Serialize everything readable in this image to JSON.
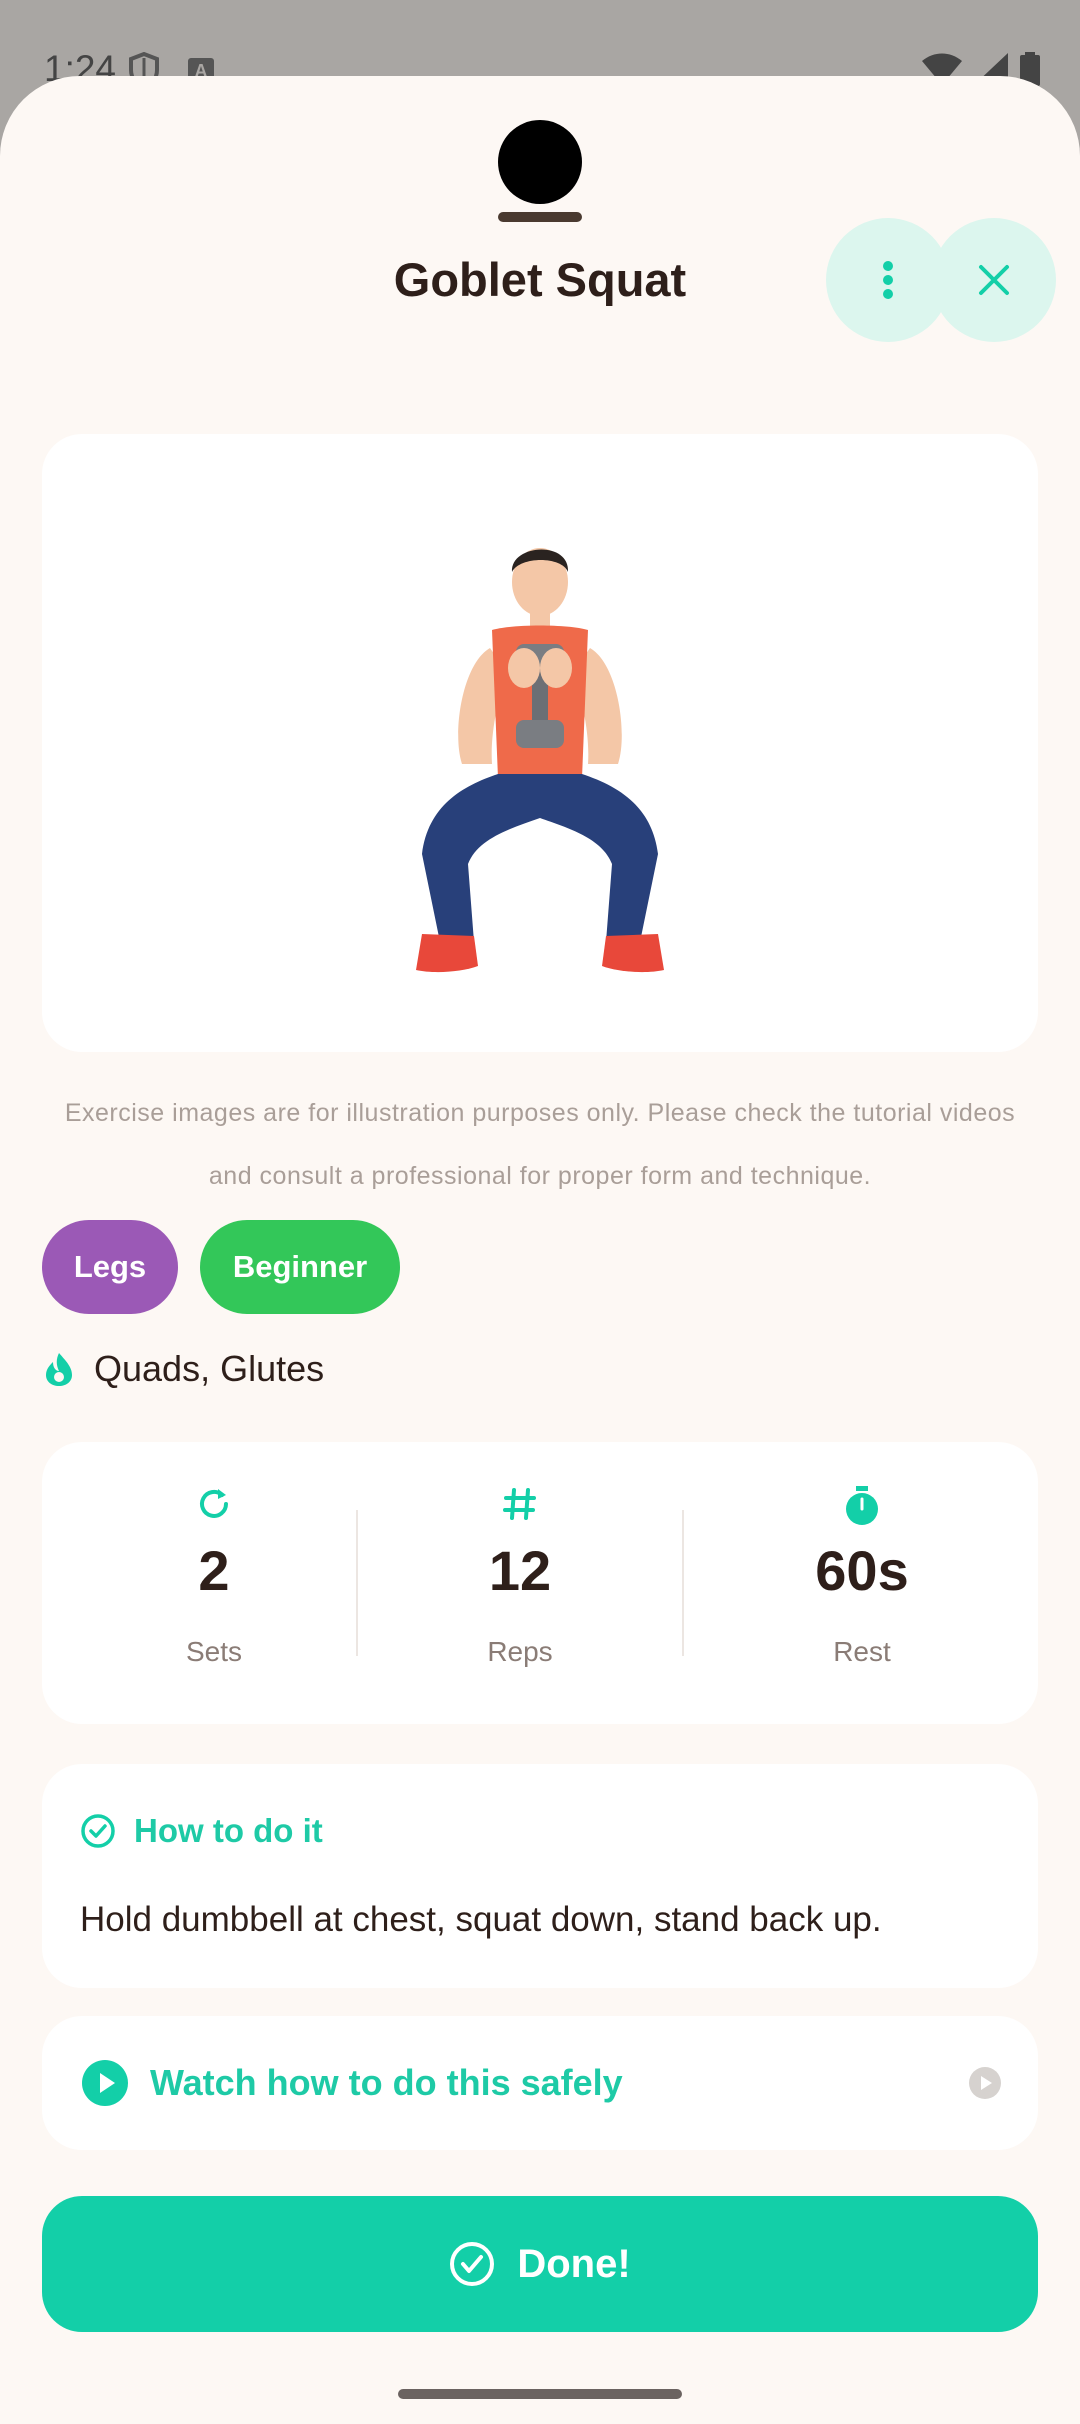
{
  "status": {
    "time": "1:24"
  },
  "header": {
    "title": "Goblet Squat"
  },
  "disclaimer": "Exercise images are for illustration purposes only. Please check the tutorial videos and consult a professional for proper form and technique.",
  "tags": {
    "category": "Legs",
    "level": "Beginner"
  },
  "muscles": "Quads, Glutes",
  "stats": [
    {
      "icon": "refresh-icon",
      "value": "2",
      "label": "Sets"
    },
    {
      "icon": "hash-icon",
      "value": "12",
      "label": "Reps"
    },
    {
      "icon": "timer-icon",
      "value": "60s",
      "label": "Rest"
    }
  ],
  "howto": {
    "heading": "How to do it",
    "text": "Hold dumbbell at chest, squat down, stand back up."
  },
  "video": {
    "label": "Watch how to do this safely"
  },
  "done": {
    "label": "Done!"
  },
  "colors": {
    "accent": "#13cfa8",
    "legs": "#9b59b6",
    "beginner": "#33c759",
    "background": "#fdf8f4"
  }
}
